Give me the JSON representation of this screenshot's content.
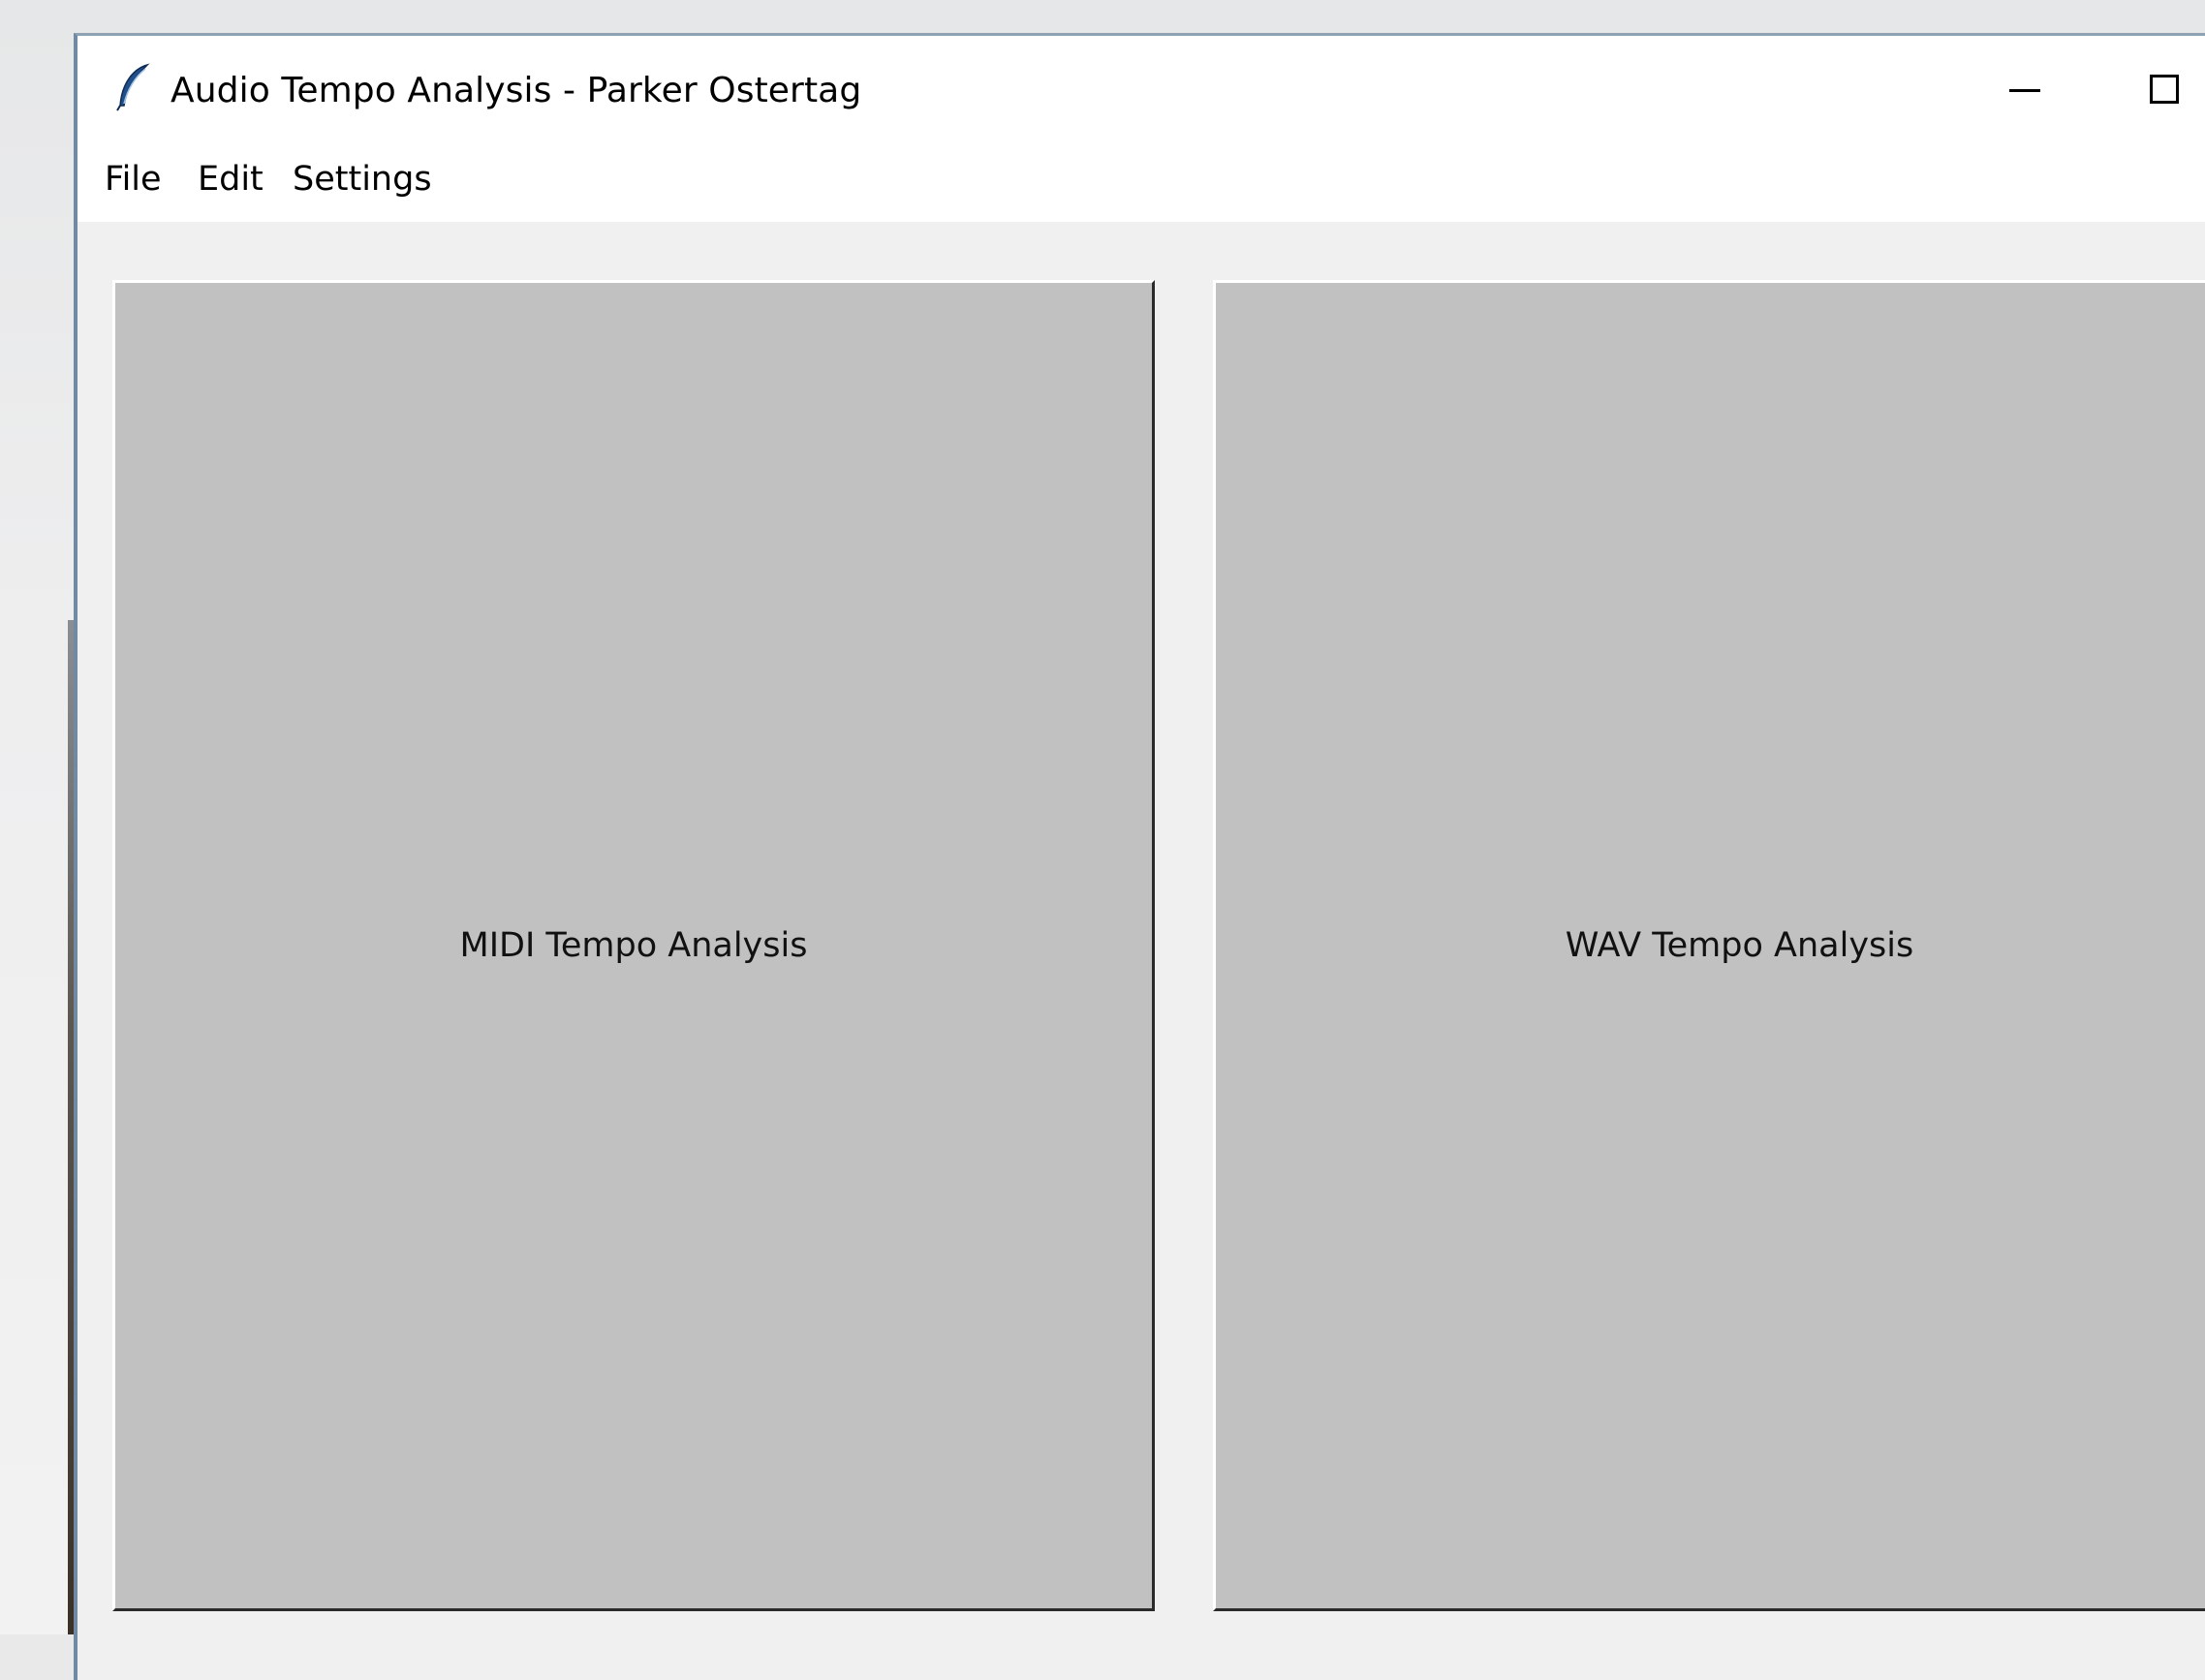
{
  "window": {
    "title": "Audio Tempo Analysis - Parker Ostertag",
    "icon": "feather-icon",
    "controls": {
      "minimize": "minimize-icon",
      "maximize": "maximize-icon",
      "close": "close-icon"
    }
  },
  "menubar": {
    "items": [
      {
        "label": "File"
      },
      {
        "label": "Edit"
      },
      {
        "label": "Settings"
      }
    ]
  },
  "main": {
    "buttons": [
      {
        "label": "MIDI Tempo Analysis"
      },
      {
        "label": "WAV Tempo Analysis"
      }
    ]
  },
  "colors": {
    "button_face": "#c1c1c1",
    "window_bg": "#f0f0f0",
    "titlebar_bg": "#ffffff",
    "window_border": "#6f8aa2"
  }
}
